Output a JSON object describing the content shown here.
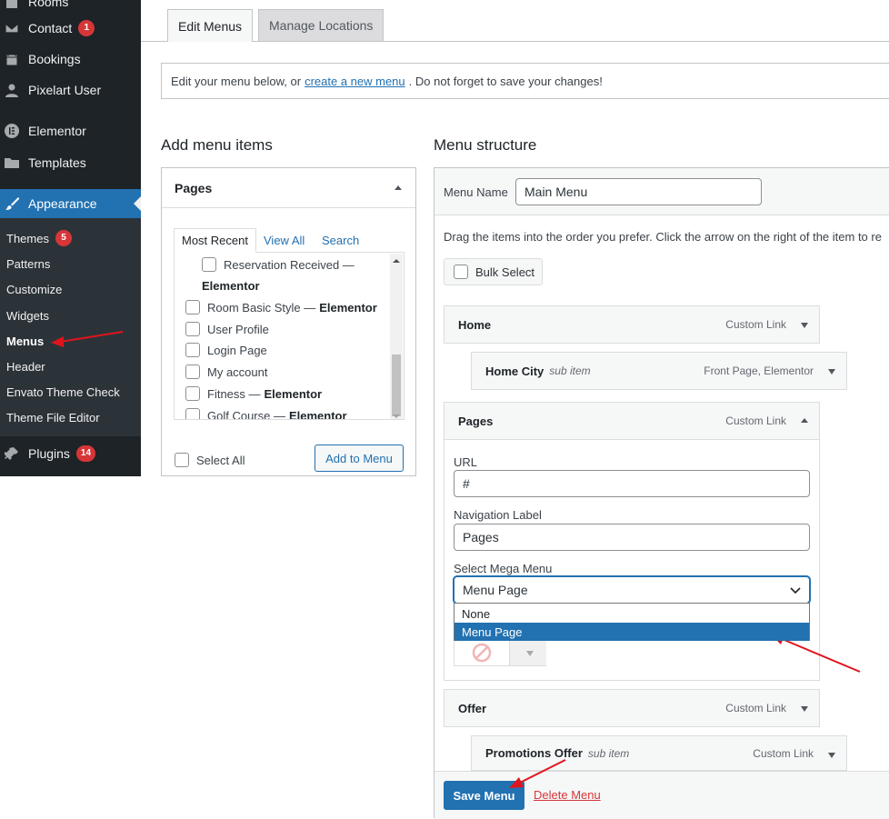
{
  "sidebar": {
    "items": [
      {
        "label": "Rooms",
        "icon": "building-icon"
      },
      {
        "label": "Contact",
        "icon": "mail-icon",
        "badge": "1"
      },
      {
        "label": "Bookings",
        "icon": "calendar-icon"
      },
      {
        "label": "Pixelart User",
        "icon": "user-icon"
      },
      {
        "label": "Elementor",
        "icon": "elementor-icon"
      },
      {
        "label": "Templates",
        "icon": "folder-icon"
      },
      {
        "label": "Appearance",
        "icon": "paintbrush-icon"
      },
      {
        "label": "Plugins",
        "icon": "plugin-icon",
        "badge": "14"
      }
    ],
    "appearance_submenu": [
      {
        "label": "Themes",
        "badge": "5"
      },
      {
        "label": "Patterns"
      },
      {
        "label": "Customize"
      },
      {
        "label": "Widgets"
      },
      {
        "label": "Menus"
      },
      {
        "label": "Header"
      },
      {
        "label": "Envato Theme Check"
      },
      {
        "label": "Theme File Editor"
      }
    ]
  },
  "tabs": [
    "Edit Menus",
    "Manage Locations"
  ],
  "notice": {
    "before": "Edit your menu below, or",
    "link": "create a new menu",
    "after": ". Do not forget to save your changes!"
  },
  "add_items": {
    "heading": "Add menu items",
    "panel_title": "Pages",
    "subtabs": [
      "Most Recent",
      "View All",
      "Search"
    ],
    "pages": [
      {
        "label": "Reservation Received —",
        "suffix": ""
      },
      {
        "label": "Elementor",
        "suffix": ""
      },
      {
        "label": "Room Basic Style —",
        "suffix": "Elementor"
      },
      {
        "label": "User Profile",
        "suffix": ""
      },
      {
        "label": "Login Page",
        "suffix": ""
      },
      {
        "label": "My account",
        "suffix": ""
      },
      {
        "label": "Fitness —",
        "suffix": "Elementor"
      },
      {
        "label": "Golf Course —",
        "suffix": "Elementor"
      }
    ],
    "select_all": "Select All",
    "add_button": "Add to Menu"
  },
  "structure": {
    "heading": "Menu structure",
    "menu_name_label": "Menu Name",
    "menu_name_value": "Main Menu",
    "instructions": "Drag the items into the order you prefer. Click the arrow on the right of the item to re",
    "bulk_select": "Bulk Select",
    "items": [
      {
        "title": "Home",
        "sub": "",
        "type": "Custom Link"
      },
      {
        "title": "Home City",
        "sub": "sub item",
        "type": "Front Page, Elementor"
      },
      {
        "title": "Pages",
        "sub": "",
        "type": "Custom Link"
      },
      {
        "title": "Offer",
        "sub": "",
        "type": "Custom Link"
      },
      {
        "title": "Promotions Offer",
        "sub": "sub item",
        "type": "Custom Link"
      }
    ],
    "settings": {
      "url_label": "URL",
      "url_value": "#",
      "nav_label": "Navigation Label",
      "nav_value": "Pages",
      "mega_label": "Select Mega Menu",
      "mega_value": "Menu Page",
      "mega_options": [
        "None",
        "Menu Page"
      ]
    },
    "save_button": "Save Menu",
    "delete_link": "Delete Menu"
  },
  "colors": {
    "sidebar_bg": "#1d2327",
    "accent": "#2271b1",
    "badge": "#d63638",
    "annotation_arrow": "#e0141e"
  }
}
